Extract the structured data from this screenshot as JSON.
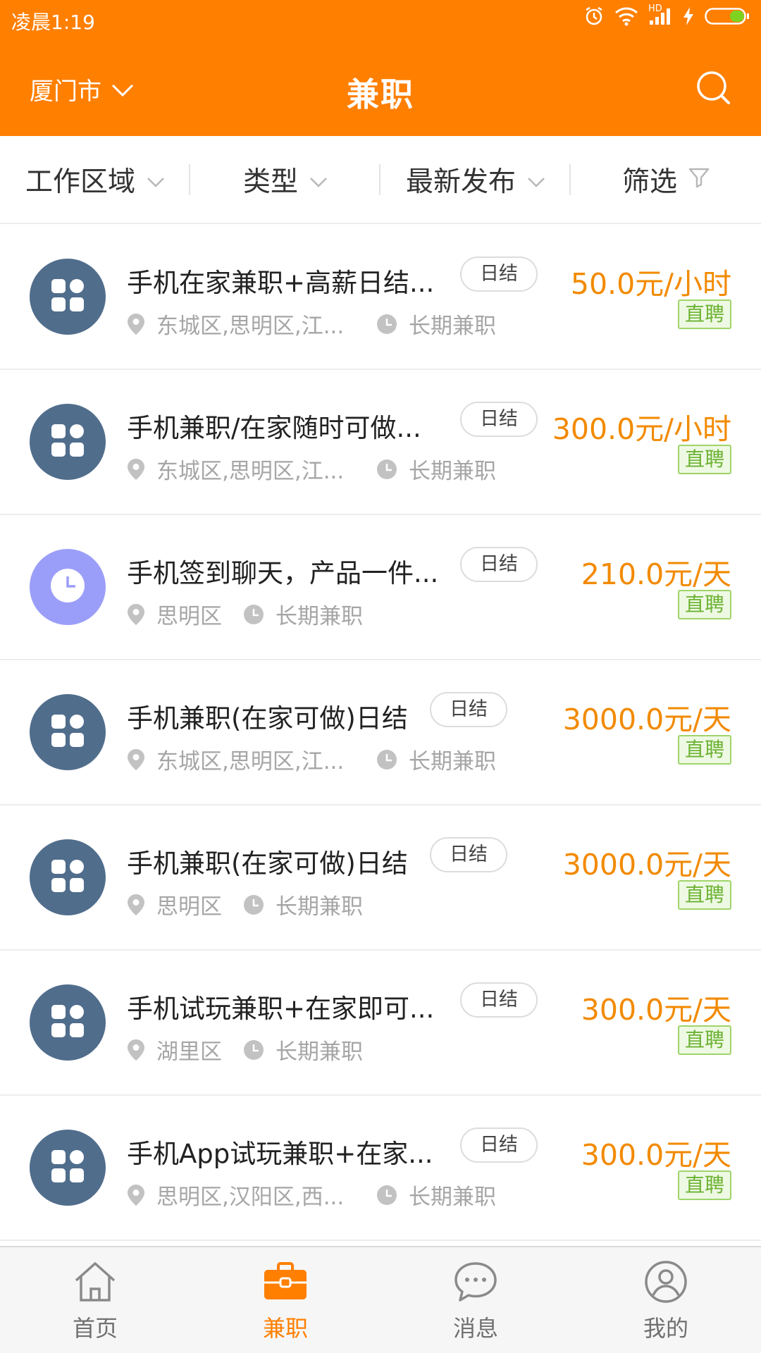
{
  "status": {
    "time": "凌晨1:19",
    "net_label": "HD"
  },
  "colors": {
    "brand": "#ff7f00",
    "price": "#f28a00",
    "badge_green": "#6cb233",
    "avatar_apps": "#506d8c",
    "avatar_clock": "#9b9ef8"
  },
  "header": {
    "city": "厦门市",
    "title": "兼职",
    "search_icon": "search-icon"
  },
  "filters": [
    {
      "label": "工作区域",
      "icon": "chevron-down-icon"
    },
    {
      "label": "类型",
      "icon": "chevron-down-icon"
    },
    {
      "label": "最新发布",
      "icon": "chevron-down-icon"
    },
    {
      "label": "筛选",
      "icon": "filter-icon"
    }
  ],
  "jobs": [
    {
      "title": "手机在家兼职+高薪日结...",
      "tag": "日结",
      "location": "东城区,思明区,江...",
      "duration": "长期兼职",
      "price": "50.0元/小时",
      "badge": "直聘",
      "avatar": "apps-icon"
    },
    {
      "title": "手机兼职/在家随时可做...",
      "tag": "日结",
      "location": "东城区,思明区,江...",
      "duration": "长期兼职",
      "price": "300.0元/小时",
      "badge": "直聘",
      "avatar": "apps-icon"
    },
    {
      "title": "手机签到聊天，产品一件...",
      "tag": "日结",
      "location": "思明区",
      "duration": "长期兼职",
      "price": "210.0元/天",
      "badge": "直聘",
      "avatar": "clock-icon"
    },
    {
      "title": "手机兼职(在家可做)日结",
      "tag": "日结",
      "location": "东城区,思明区,江...",
      "duration": "长期兼职",
      "price": "3000.0元/天",
      "badge": "直聘",
      "avatar": "apps-icon"
    },
    {
      "title": "手机兼职(在家可做)日结",
      "tag": "日结",
      "location": "思明区",
      "duration": "长期兼职",
      "price": "3000.0元/天",
      "badge": "直聘",
      "avatar": "apps-icon"
    },
    {
      "title": "手机试玩兼职+在家即可...",
      "tag": "日结",
      "location": "湖里区",
      "duration": "长期兼职",
      "price": "300.0元/天",
      "badge": "直聘",
      "avatar": "apps-icon"
    },
    {
      "title": "手机App试玩兼职+在家...",
      "tag": "日结",
      "location": "思明区,汉阳区,西...",
      "duration": "长期兼职",
      "price": "300.0元/天",
      "badge": "直聘",
      "avatar": "apps-icon"
    }
  ],
  "tabs": [
    {
      "label": "首页",
      "icon": "home-icon",
      "active": false
    },
    {
      "label": "兼职",
      "icon": "briefcase-icon",
      "active": true
    },
    {
      "label": "消息",
      "icon": "message-icon",
      "active": false
    },
    {
      "label": "我的",
      "icon": "profile-icon",
      "active": false
    }
  ]
}
